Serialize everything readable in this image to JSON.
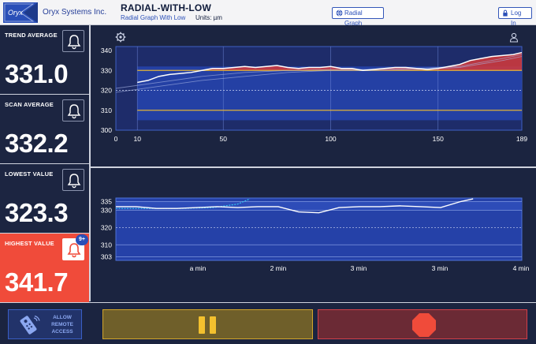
{
  "header": {
    "logo_text": "Oryx",
    "company": "Oryx Systems Inc.",
    "title": "RADIAL-WITH-LOW",
    "subtitle": "Radial Graph With Low",
    "units": "Units: µm",
    "radial_button": "Radial Graph",
    "login_button": "Log In"
  },
  "stats": [
    {
      "label": "TREND AVERAGE",
      "value": "331.0"
    },
    {
      "label": "SCAN AVERAGE",
      "value": "332.2"
    },
    {
      "label": "LOWEST VALUE",
      "value": "323.3"
    },
    {
      "label": "HIGHEST VALUE",
      "value": "341.7",
      "badge": "9+"
    }
  ],
  "colors": {
    "band": "#2541a8",
    "band_dark": "#1e2c6a",
    "high_fill": "#d63a3a",
    "limit_line": "#e0b23a",
    "highlight": "#f04b3a",
    "trace": "#ffffff",
    "cyan": "#33c6f0"
  },
  "chart_data": [
    {
      "type": "line",
      "title": "",
      "x_ticks": [
        "0",
        "10",
        "50",
        "100",
        "150",
        "189"
      ],
      "y_ticks": [
        "340",
        "330",
        "320",
        "310",
        "300"
      ],
      "xlim": [
        0,
        189
      ],
      "ylim": [
        300,
        342
      ],
      "x_band": [
        10,
        189
      ],
      "upper_limit": 330,
      "lower_limit": 310,
      "center_line": 320,
      "series": [
        {
          "values_x": [
            10,
            15,
            20,
            25,
            30,
            35,
            40,
            45,
            50,
            55,
            60,
            65,
            70,
            75,
            80,
            85,
            90,
            95,
            100,
            105,
            110,
            115,
            120,
            125,
            130,
            135,
            140,
            145,
            150,
            155,
            160,
            165,
            170,
            175,
            180,
            185,
            189
          ],
          "values_y": [
            324,
            325,
            327,
            328,
            328.5,
            329,
            330,
            331,
            331,
            331.5,
            332,
            331.5,
            332,
            332.5,
            331.5,
            331,
            331.5,
            331.5,
            332,
            331,
            331,
            330,
            330.5,
            331,
            331.5,
            331.5,
            331,
            330.5,
            331,
            332,
            333,
            335,
            336,
            337,
            337.5,
            338,
            339
          ]
        },
        {
          "values_x": [
            0,
            20,
            40,
            60,
            80,
            100,
            120,
            140,
            160,
            180,
            189
          ],
          "values_y": [
            321,
            324,
            327,
            329,
            330,
            330.5,
            330.5,
            331,
            332,
            336,
            338
          ]
        },
        {
          "values_x": [
            0,
            20,
            40,
            60,
            80,
            100,
            120,
            140,
            160,
            180,
            189
          ],
          "values_y": [
            319,
            322,
            325,
            327,
            329,
            330,
            330,
            330.5,
            331.5,
            335,
            337
          ]
        }
      ]
    },
    {
      "type": "line",
      "title": "",
      "x_ticks": [
        "a min",
        "2 min",
        "3 min",
        "3 min",
        "4 min"
      ],
      "y_ticks": [
        "335",
        "330",
        "320",
        "310",
        "303"
      ],
      "ylim": [
        301,
        337
      ],
      "tick_values": [
        335,
        330,
        320,
        310,
        303
      ],
      "series": [
        {
          "values_x": [
            0,
            0.05,
            0.1,
            0.15,
            0.2,
            0.25,
            0.3,
            0.35,
            0.4,
            0.45,
            0.5,
            0.55,
            0.6,
            0.65,
            0.7,
            0.75,
            0.8,
            0.85,
            0.88
          ],
          "values_y": [
            332,
            332,
            331,
            331,
            331.5,
            332,
            331.5,
            332,
            332,
            329,
            328.5,
            331.5,
            332,
            332,
            332.5,
            332,
            331.5,
            335,
            336.5
          ]
        },
        {
          "values_x": [
            0,
            0.08,
            0.16,
            0.24,
            0.3,
            0.33
          ],
          "values_y": [
            331,
            331,
            331,
            331.5,
            333.5,
            336.5
          ]
        }
      ]
    }
  ]
}
